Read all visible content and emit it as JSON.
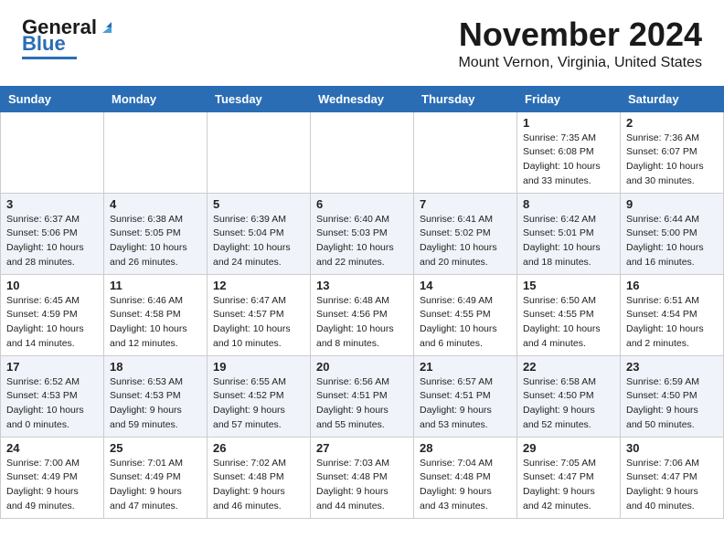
{
  "header": {
    "logo_general": "General",
    "logo_blue": "Blue",
    "month": "November 2024",
    "location": "Mount Vernon, Virginia, United States"
  },
  "days_of_week": [
    "Sunday",
    "Monday",
    "Tuesday",
    "Wednesday",
    "Thursday",
    "Friday",
    "Saturday"
  ],
  "weeks": [
    [
      {
        "day": "",
        "info": ""
      },
      {
        "day": "",
        "info": ""
      },
      {
        "day": "",
        "info": ""
      },
      {
        "day": "",
        "info": ""
      },
      {
        "day": "",
        "info": ""
      },
      {
        "day": "1",
        "info": "Sunrise: 7:35 AM\nSunset: 6:08 PM\nDaylight: 10 hours\nand 33 minutes."
      },
      {
        "day": "2",
        "info": "Sunrise: 7:36 AM\nSunset: 6:07 PM\nDaylight: 10 hours\nand 30 minutes."
      }
    ],
    [
      {
        "day": "3",
        "info": "Sunrise: 6:37 AM\nSunset: 5:06 PM\nDaylight: 10 hours\nand 28 minutes."
      },
      {
        "day": "4",
        "info": "Sunrise: 6:38 AM\nSunset: 5:05 PM\nDaylight: 10 hours\nand 26 minutes."
      },
      {
        "day": "5",
        "info": "Sunrise: 6:39 AM\nSunset: 5:04 PM\nDaylight: 10 hours\nand 24 minutes."
      },
      {
        "day": "6",
        "info": "Sunrise: 6:40 AM\nSunset: 5:03 PM\nDaylight: 10 hours\nand 22 minutes."
      },
      {
        "day": "7",
        "info": "Sunrise: 6:41 AM\nSunset: 5:02 PM\nDaylight: 10 hours\nand 20 minutes."
      },
      {
        "day": "8",
        "info": "Sunrise: 6:42 AM\nSunset: 5:01 PM\nDaylight: 10 hours\nand 18 minutes."
      },
      {
        "day": "9",
        "info": "Sunrise: 6:44 AM\nSunset: 5:00 PM\nDaylight: 10 hours\nand 16 minutes."
      }
    ],
    [
      {
        "day": "10",
        "info": "Sunrise: 6:45 AM\nSunset: 4:59 PM\nDaylight: 10 hours\nand 14 minutes."
      },
      {
        "day": "11",
        "info": "Sunrise: 6:46 AM\nSunset: 4:58 PM\nDaylight: 10 hours\nand 12 minutes."
      },
      {
        "day": "12",
        "info": "Sunrise: 6:47 AM\nSunset: 4:57 PM\nDaylight: 10 hours\nand 10 minutes."
      },
      {
        "day": "13",
        "info": "Sunrise: 6:48 AM\nSunset: 4:56 PM\nDaylight: 10 hours\nand 8 minutes."
      },
      {
        "day": "14",
        "info": "Sunrise: 6:49 AM\nSunset: 4:55 PM\nDaylight: 10 hours\nand 6 minutes."
      },
      {
        "day": "15",
        "info": "Sunrise: 6:50 AM\nSunset: 4:55 PM\nDaylight: 10 hours\nand 4 minutes."
      },
      {
        "day": "16",
        "info": "Sunrise: 6:51 AM\nSunset: 4:54 PM\nDaylight: 10 hours\nand 2 minutes."
      }
    ],
    [
      {
        "day": "17",
        "info": "Sunrise: 6:52 AM\nSunset: 4:53 PM\nDaylight: 10 hours\nand 0 minutes."
      },
      {
        "day": "18",
        "info": "Sunrise: 6:53 AM\nSunset: 4:53 PM\nDaylight: 9 hours\nand 59 minutes."
      },
      {
        "day": "19",
        "info": "Sunrise: 6:55 AM\nSunset: 4:52 PM\nDaylight: 9 hours\nand 57 minutes."
      },
      {
        "day": "20",
        "info": "Sunrise: 6:56 AM\nSunset: 4:51 PM\nDaylight: 9 hours\nand 55 minutes."
      },
      {
        "day": "21",
        "info": "Sunrise: 6:57 AM\nSunset: 4:51 PM\nDaylight: 9 hours\nand 53 minutes."
      },
      {
        "day": "22",
        "info": "Sunrise: 6:58 AM\nSunset: 4:50 PM\nDaylight: 9 hours\nand 52 minutes."
      },
      {
        "day": "23",
        "info": "Sunrise: 6:59 AM\nSunset: 4:50 PM\nDaylight: 9 hours\nand 50 minutes."
      }
    ],
    [
      {
        "day": "24",
        "info": "Sunrise: 7:00 AM\nSunset: 4:49 PM\nDaylight: 9 hours\nand 49 minutes."
      },
      {
        "day": "25",
        "info": "Sunrise: 7:01 AM\nSunset: 4:49 PM\nDaylight: 9 hours\nand 47 minutes."
      },
      {
        "day": "26",
        "info": "Sunrise: 7:02 AM\nSunset: 4:48 PM\nDaylight: 9 hours\nand 46 minutes."
      },
      {
        "day": "27",
        "info": "Sunrise: 7:03 AM\nSunset: 4:48 PM\nDaylight: 9 hours\nand 44 minutes."
      },
      {
        "day": "28",
        "info": "Sunrise: 7:04 AM\nSunset: 4:48 PM\nDaylight: 9 hours\nand 43 minutes."
      },
      {
        "day": "29",
        "info": "Sunrise: 7:05 AM\nSunset: 4:47 PM\nDaylight: 9 hours\nand 42 minutes."
      },
      {
        "day": "30",
        "info": "Sunrise: 7:06 AM\nSunset: 4:47 PM\nDaylight: 9 hours\nand 40 minutes."
      }
    ]
  ]
}
